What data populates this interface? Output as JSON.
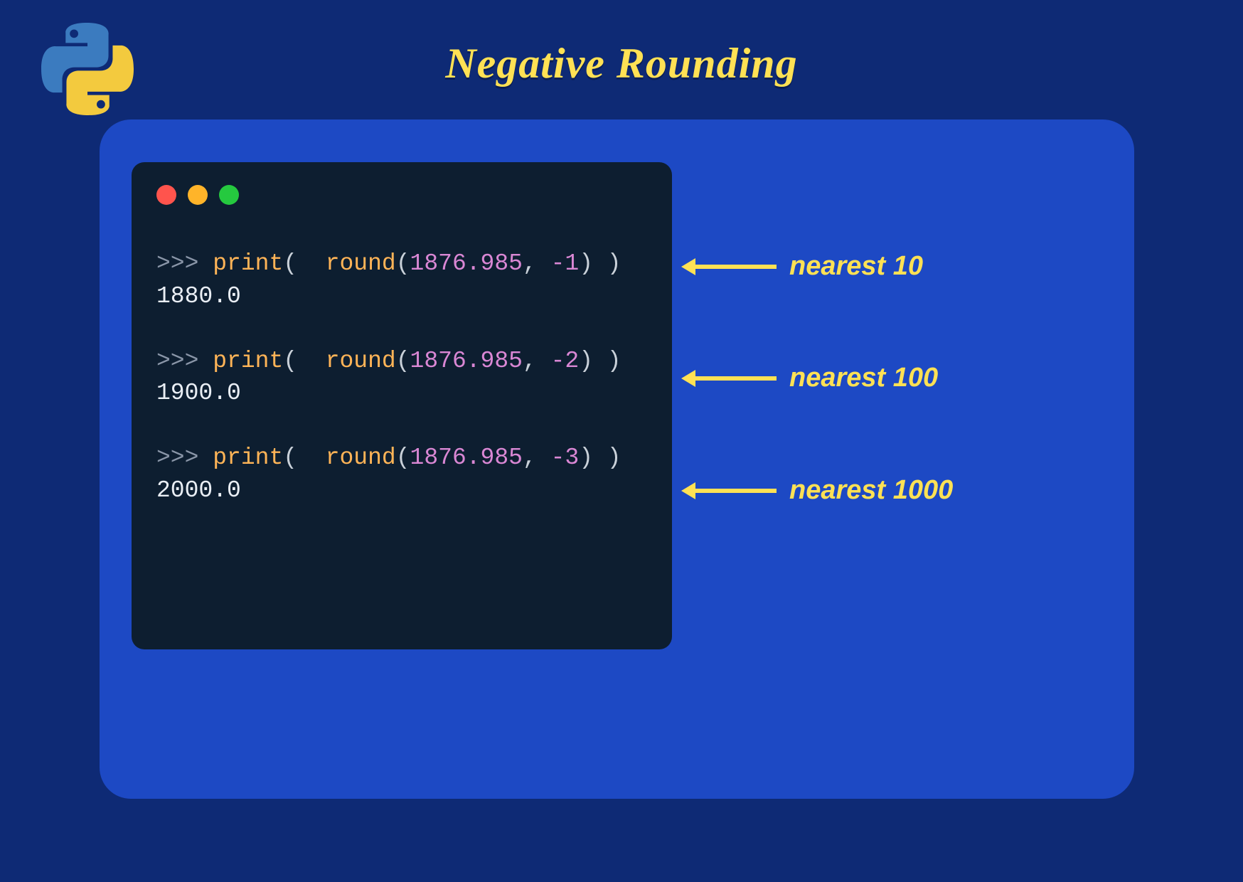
{
  "title": "Negative Rounding",
  "code": {
    "examples": [
      {
        "round_arg1": "1876.985",
        "round_arg2": "-1",
        "output": "1880.0"
      },
      {
        "round_arg1": "1876.985",
        "round_arg2": "-2",
        "output": "1900.0"
      },
      {
        "round_arg1": "1876.985",
        "round_arg2": "-3",
        "output": "2000.0"
      }
    ],
    "prompt": ">>>",
    "func_print": "print",
    "func_round": "round",
    "sep": ", "
  },
  "annotations": [
    "nearest 10",
    "nearest 100",
    "nearest 1000"
  ]
}
